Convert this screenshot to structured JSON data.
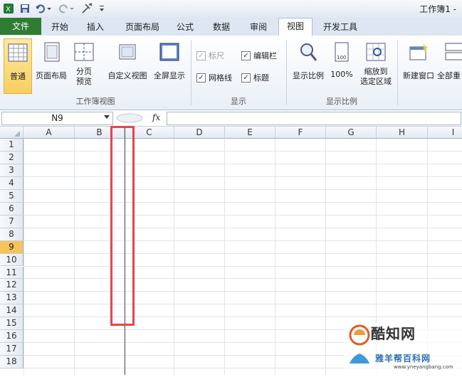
{
  "window": {
    "title": "工作簿1 -"
  },
  "tabs": [
    {
      "id": "file",
      "label": "文件"
    },
    {
      "id": "home",
      "label": "开始"
    },
    {
      "id": "insert",
      "label": "插入"
    },
    {
      "id": "page_layout",
      "label": "页面布局"
    },
    {
      "id": "formulas",
      "label": "公式"
    },
    {
      "id": "data",
      "label": "数据"
    },
    {
      "id": "review",
      "label": "审阅"
    },
    {
      "id": "view",
      "label": "视图"
    },
    {
      "id": "developer",
      "label": "开发工具"
    }
  ],
  "ribbon": {
    "workbook_views": {
      "label": "工作簿视图",
      "normal": "普通",
      "page_layout": "页面布局",
      "page_break_1": "分页",
      "page_break_2": "预览",
      "custom_views": "自定义视图",
      "full_screen": "全屏显示"
    },
    "show": {
      "label": "显示",
      "ruler": "标尺",
      "formula_bar": "编辑栏",
      "gridlines": "网格线",
      "headings": "标题",
      "ruler_checked": "✓",
      "formula_bar_checked": "✓",
      "gridlines_checked": "✓",
      "headings_checked": "✓"
    },
    "zoom": {
      "label": "显示比例",
      "zoom": "显示比例",
      "zoom100": "100%",
      "zoom_sel_1": "缩放到",
      "zoom_sel_2": "选定区域"
    },
    "window": {
      "new_window": "新建窗口",
      "arrange_all": "全部重"
    }
  },
  "formula_bar": {
    "name_box": "N9",
    "fx": "fx",
    "value": ""
  },
  "columns": [
    "A",
    "B",
    "C",
    "D",
    "E",
    "F",
    "G",
    "H",
    "I"
  ],
  "rows": [
    "1",
    "2",
    "3",
    "4",
    "5",
    "6",
    "7",
    "8",
    "9",
    "10",
    "11",
    "12",
    "13",
    "14",
    "15",
    "16",
    "17",
    "18"
  ],
  "selected_row": "9",
  "watermark": {
    "brand": "酷知网",
    "site": "www.yneyangbang.com",
    "brand2": "雅羊帮百科网"
  }
}
